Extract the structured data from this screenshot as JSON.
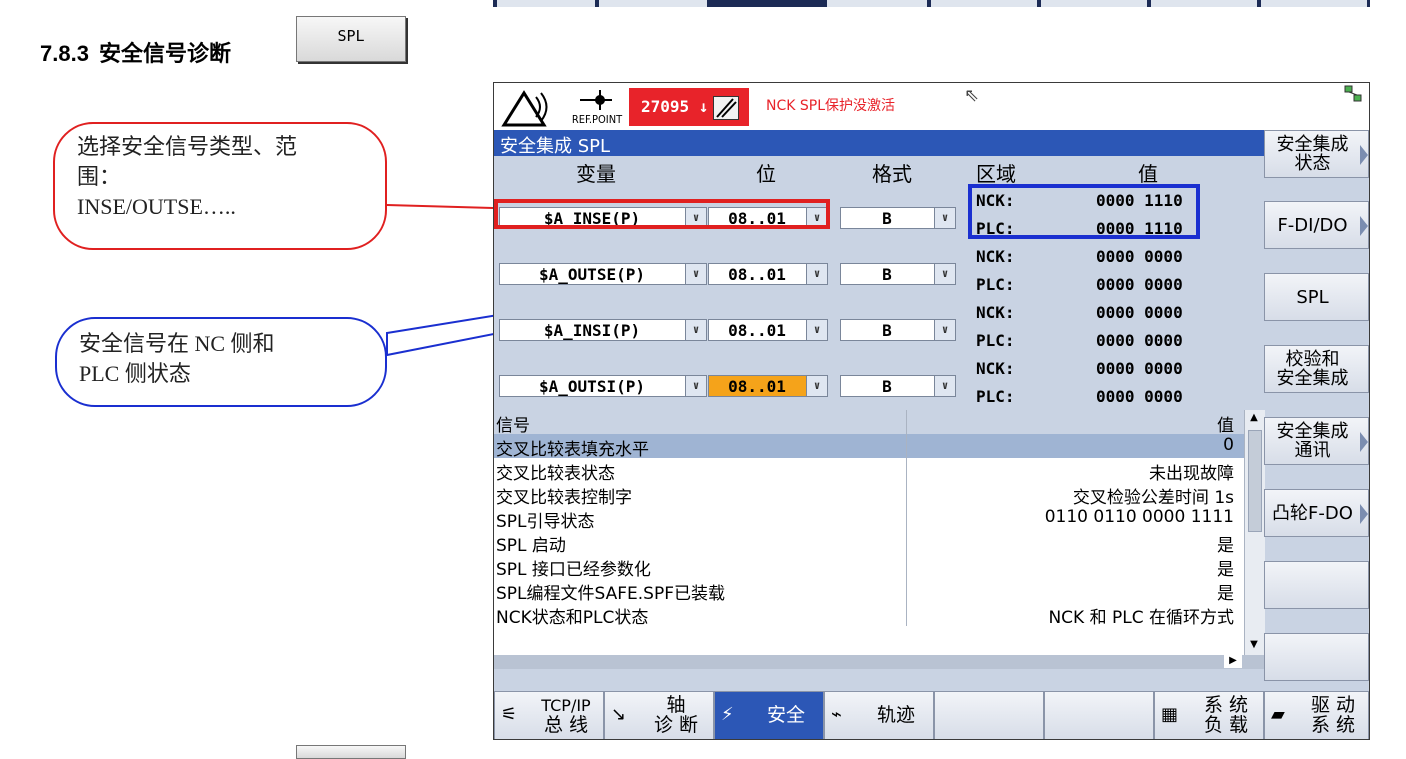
{
  "page": {
    "section_number": "7.8.3",
    "section_title": "安全信号诊断",
    "section_button": "SPL",
    "callout_red": [
      "选择安全信号类型、范",
      "围：",
      "INSE/OUTSE….."
    ],
    "callout_blue": [
      "安全信号在 NC 侧和",
      "PLC 侧状态"
    ]
  },
  "header": {
    "ref_point": "REF.POINT",
    "alarm_number": "27095",
    "alarm_text": "NCK SPL保护没激活"
  },
  "window_title": "安全集成 SPL",
  "columns": {
    "variable": "变量",
    "bit": "位",
    "format": "格式",
    "area": "区域",
    "value": "值"
  },
  "rows": [
    {
      "variable": "$A_INSE(P)",
      "bit": "08..01",
      "format": "B",
      "nck_label": "NCK:",
      "nck_value": "0000 1110",
      "plc_label": "PLC:",
      "plc_value": "0000 1110"
    },
    {
      "variable": "$A_OUTSE(P)",
      "bit": "08..01",
      "format": "B",
      "nck_label": "NCK:",
      "nck_value": "0000 0000",
      "plc_label": "PLC:",
      "plc_value": "0000 0000"
    },
    {
      "variable": "$A_INSI(P)",
      "bit": "08..01",
      "format": "B",
      "nck_label": "NCK:",
      "nck_value": "0000 0000",
      "plc_label": "PLC:",
      "plc_value": "0000 0000"
    },
    {
      "variable": "$A_OUTSI(P)",
      "bit": "08..01",
      "format": "B",
      "nck_label": "NCK:",
      "nck_value": "0000 0000",
      "plc_label": "PLC:",
      "plc_value": "0000 0000"
    }
  ],
  "signal_table": {
    "header_signal": "信号",
    "header_value": "值",
    "rows": [
      {
        "signal": "交叉比较表填充水平",
        "value": "0"
      },
      {
        "signal": "交叉比较表状态",
        "value": "未出现故障"
      },
      {
        "signal": "交叉比较表控制字",
        "value": "交叉检验公差时间 1s"
      },
      {
        "signal": "SPL引导状态",
        "value": "0110 0110 0000 1111"
      },
      {
        "signal": "SPL 启动",
        "value": "是"
      },
      {
        "signal": "SPL 接口已经参数化",
        "value": "是"
      },
      {
        "signal": "SPL编程文件SAFE.SPF已装载",
        "value": "是"
      },
      {
        "signal": "NCK状态和PLC状态",
        "value": "NCK 和 PLC 在循环方式"
      }
    ]
  },
  "right_softkeys": [
    {
      "line1": "安全集成",
      "line2": "状态"
    },
    {
      "line1": "F-DI/DO",
      "line2": ""
    },
    {
      "line1": "SPL",
      "line2": ""
    },
    {
      "line1": "校验和",
      "line2": "安全集成"
    },
    {
      "line1": "安全集成",
      "line2": "通讯"
    },
    {
      "line1": "凸轮F-DO",
      "line2": ""
    }
  ],
  "bottom_softkeys": {
    "tcpip_1": "TCP/IP",
    "tcpip_2": "总 线",
    "axis_1": "轴",
    "axis_2": "诊 断",
    "safety": "安全",
    "trace": "轨迹",
    "sysload_1": "系 统",
    "sysload_2": "负 载",
    "drive_1": "驱 动",
    "drive_2": "系 统"
  },
  "colors": {
    "title_blue": "#2c57b6",
    "alarm_red": "#e8232a",
    "highlight_orange": "#f5a31a"
  }
}
